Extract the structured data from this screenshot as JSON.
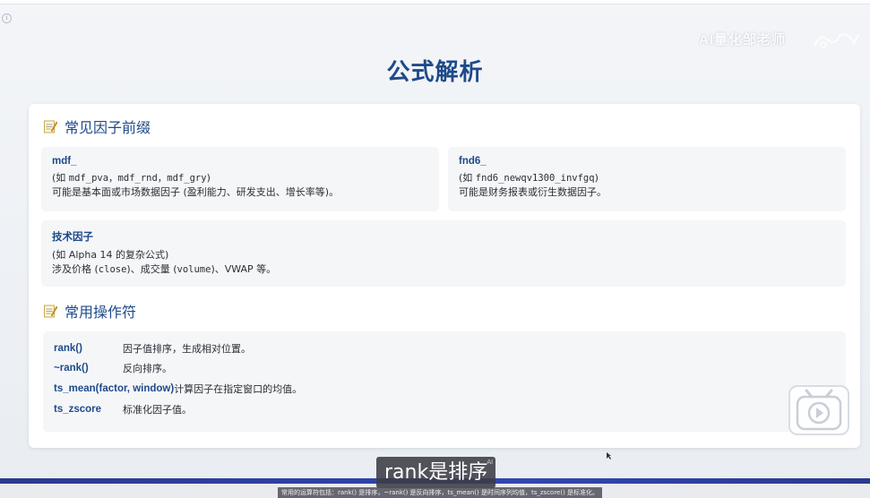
{
  "watermark": {
    "text": "AI量化邹老师"
  },
  "page": {
    "title": "公式解析"
  },
  "sections": {
    "prefixes": {
      "title": "常见因子前缀",
      "icon": "memo-icon",
      "tiles": [
        {
          "name": "mdf_",
          "line1_prefix": "(如 ",
          "line1_code": "mdf_pva，mdf_rnd，mdf_gry",
          "line1_suffix": ")",
          "line2": "可能是基本面或市场数据因子 (盈利能力、研发支出、增长率等)。"
        },
        {
          "name": "fnd6_",
          "line1_prefix": "(如 ",
          "line1_code": "fnd6_newqv1300_invfgq",
          "line1_suffix": ")",
          "line2": "可能是财务报表或衍生数据因子。"
        },
        {
          "name": "技术因子",
          "line1_prefix": "(如 Alpha 14 的复杂公式)",
          "line2_a": "涉及价格 (",
          "line2_code1": "close",
          "line2_b": ")、成交量 (",
          "line2_code2": "volume",
          "line2_c": ")、VWAP 等。"
        }
      ]
    },
    "operators": {
      "title": "常用操作符",
      "icon": "memo-icon",
      "rows": [
        {
          "name": "rank()",
          "desc": "因子值排序，生成相对位置。"
        },
        {
          "name": "~rank()",
          "desc": "反向排序。"
        },
        {
          "name": "ts_mean(factor, window)",
          "desc": "计算因子在指定窗口的均值。"
        },
        {
          "name": "ts_zscore",
          "desc": "标准化因子值。"
        }
      ]
    }
  },
  "player": {
    "subtitle": "rank是排序",
    "subtitle_badge": "AI",
    "caption": "常用的运算符包括：rank() 是排序，~rank() 是反向排序，ts_mean() 是时间序列均值，ts_zscore() 是标准化。",
    "play_icon": "play-icon"
  },
  "colors": {
    "accent": "#1e4a8a",
    "tile_bg": "#f5f6f8",
    "bar": "#3346b0"
  }
}
